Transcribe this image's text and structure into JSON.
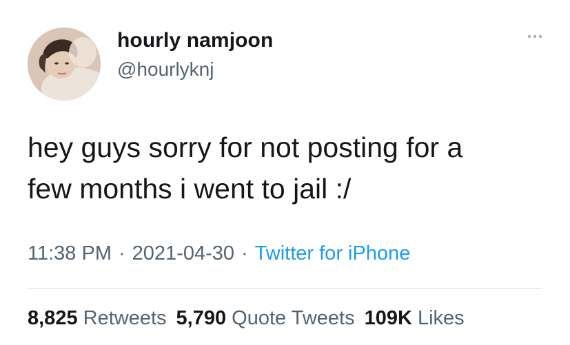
{
  "author": {
    "display_name": "hourly namjoon",
    "handle": "@hourlyknj",
    "avatar_icon": "profile-photo"
  },
  "tweet": {
    "text_line_1": "hey guys sorry for not posting for a",
    "text_line_2": "few months i went to jail :/"
  },
  "meta": {
    "time": "11:38 PM",
    "separator": "·",
    "date": "2021-04-30",
    "source": "Twitter for iPhone"
  },
  "stats": {
    "retweets_count": "8,825",
    "retweets_label": "Retweets",
    "quotes_count": "5,790",
    "quotes_label": "Quote Tweets",
    "likes_count": "109K",
    "likes_label": "Likes"
  },
  "menu": {
    "more_icon": "more-horizontal-icon"
  },
  "colors": {
    "text_primary": "#14171a",
    "text_secondary": "#536471",
    "link": "#1d9bf0",
    "divider": "#d7dee3"
  }
}
